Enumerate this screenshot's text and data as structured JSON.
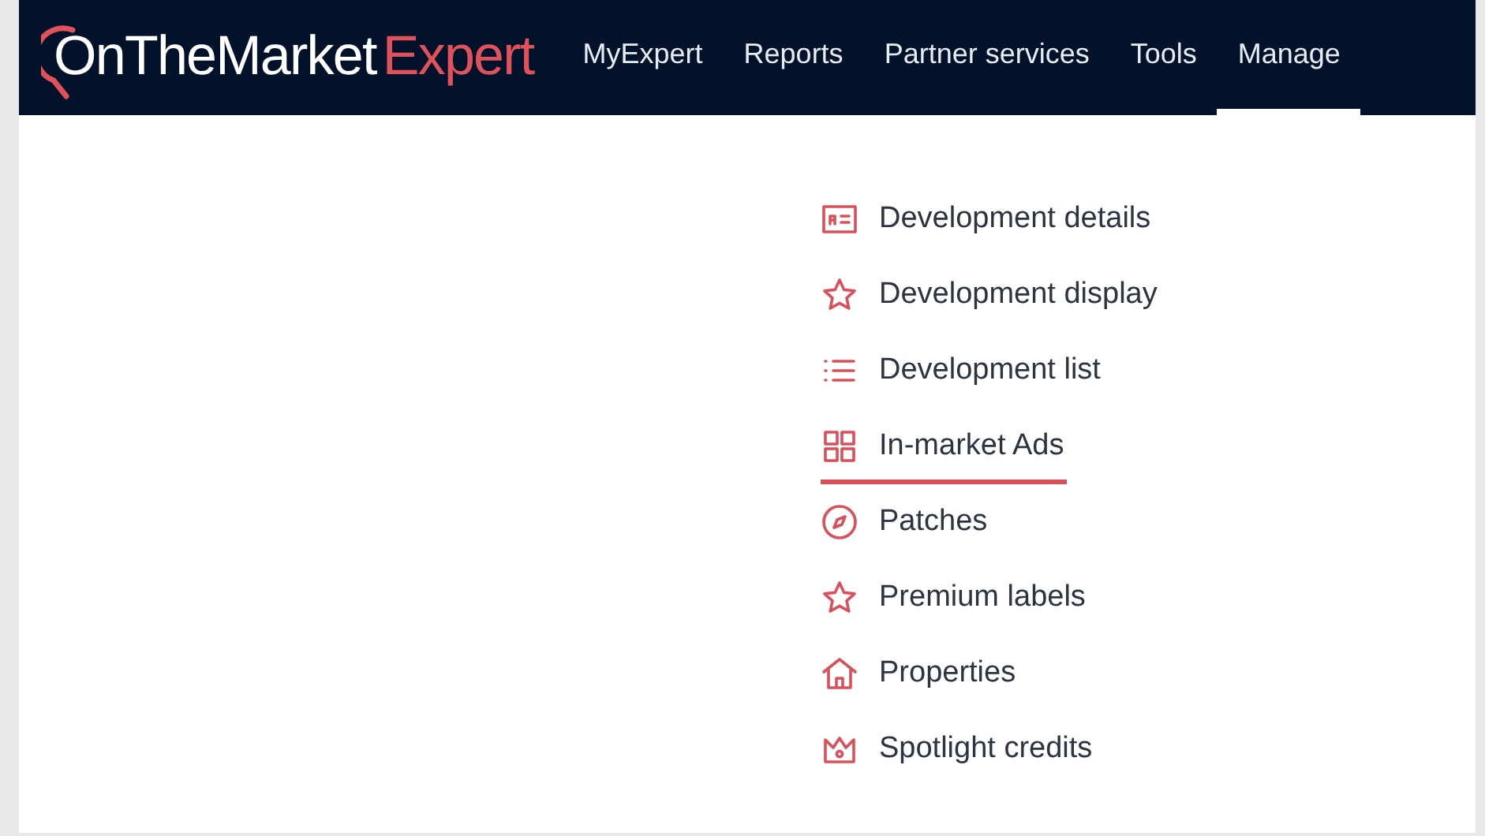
{
  "logo": {
    "main": "OnTheMarket",
    "accent": "Expert"
  },
  "nav": [
    {
      "label": "MyExpert",
      "selected": false
    },
    {
      "label": "Reports",
      "selected": false
    },
    {
      "label": "Partner services",
      "selected": false
    },
    {
      "label": "Tools",
      "selected": false
    },
    {
      "label": "Manage",
      "selected": true
    }
  ],
  "menu": [
    {
      "label": "Development details",
      "kind": "card",
      "selected": false
    },
    {
      "label": "Development display",
      "kind": "star",
      "selected": false
    },
    {
      "label": "Development list",
      "kind": "list",
      "selected": false
    },
    {
      "label": "In-market Ads",
      "kind": "grid",
      "selected": true
    },
    {
      "label": "Patches",
      "kind": "compass",
      "selected": false
    },
    {
      "label": "Premium labels",
      "kind": "star",
      "selected": false
    },
    {
      "label": "Properties",
      "kind": "house",
      "selected": false
    },
    {
      "label": "Spotlight credits",
      "kind": "crown",
      "selected": false
    }
  ]
}
